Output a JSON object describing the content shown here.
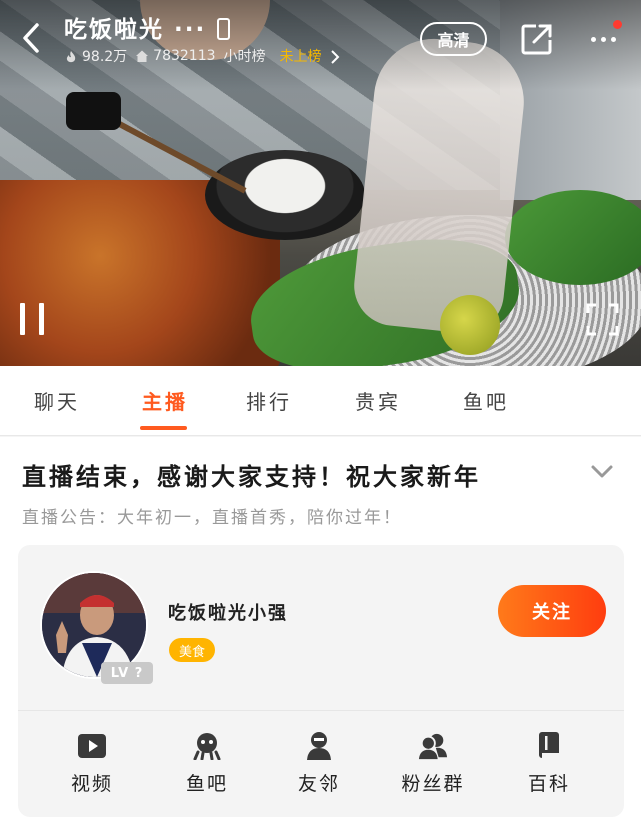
{
  "header": {
    "room_title": "吃饭啦光 ···",
    "hot_count": "98.2万",
    "room_id": "7832113",
    "rank_label": "小时榜",
    "rank_status": "未上榜",
    "quality_label": "高清"
  },
  "tabs": [
    {
      "label": "聊天"
    },
    {
      "label": "主播"
    },
    {
      "label": "排行"
    },
    {
      "label": "贵宾"
    },
    {
      "label": "鱼吧"
    }
  ],
  "active_tab": "主播",
  "content": {
    "headline": "直播结束，感谢大家支持！祝大家新年",
    "announcement": "直播公告：大年初一，直播首秀，陪你过年！"
  },
  "streamer": {
    "name": "吃饭啦光小强",
    "category_tag": "美食",
    "level_badge": "LV ?",
    "follow_label": "关注"
  },
  "quick_links": [
    {
      "label": "视频",
      "icon": "video-play-icon"
    },
    {
      "label": "鱼吧",
      "icon": "fish-bar-icon"
    },
    {
      "label": "友邻",
      "icon": "neighbor-icon"
    },
    {
      "label": "粉丝群",
      "icon": "fan-group-icon"
    },
    {
      "label": "百科",
      "icon": "encyclopedia-book-icon"
    }
  ],
  "colors": {
    "accent": "#ff5a1f",
    "tag": "#ffb400",
    "rank_status": "#f5b800"
  }
}
